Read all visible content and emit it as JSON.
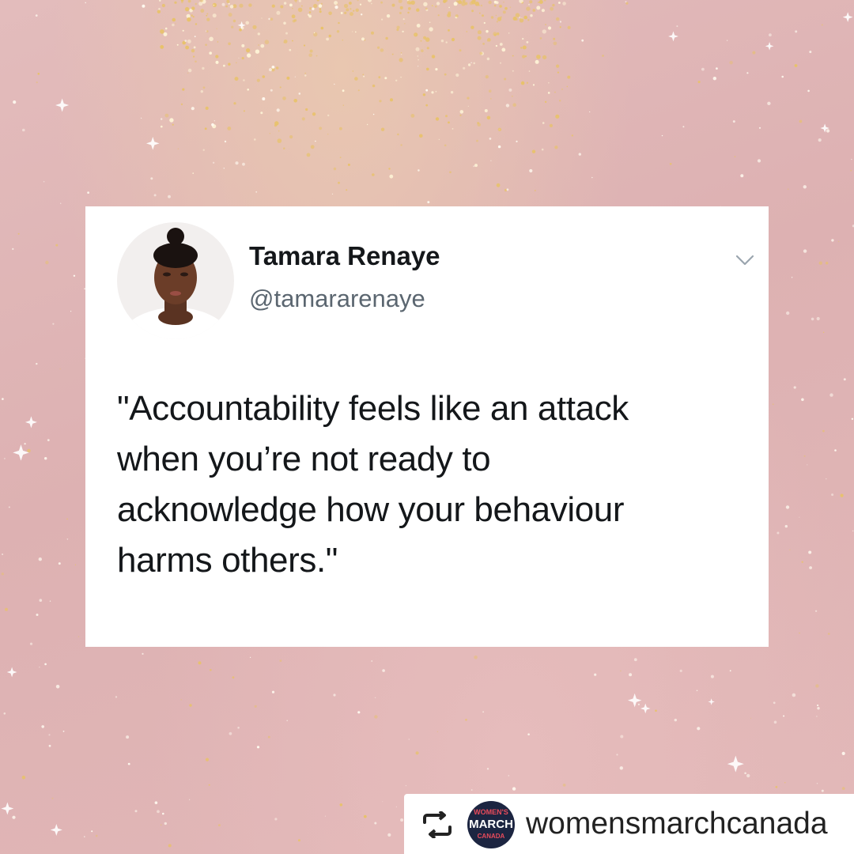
{
  "tweet": {
    "author_name": "Tamara Renaye",
    "author_handle": "@tamararenaye",
    "menu_icon": "chevron-down-icon",
    "text_lines": [
      "\"Accountability feels like an attack",
      "when you’re not ready to",
      "acknowledge how your behaviour",
      "harms others.\""
    ]
  },
  "repost": {
    "icon": "repost-icon",
    "account": "womensmarchcanada",
    "logo_lines": [
      "WOMEN'S",
      "MARCH",
      "CANADA"
    ]
  },
  "colors": {
    "background_pink": "#ddb1b2",
    "glitter_gold": "#e8c26a",
    "card": "#ffffff",
    "text": "#14171a",
    "handle": "#5b6670",
    "logo_navy": "#1c2541",
    "logo_red": "#e94b5b"
  }
}
